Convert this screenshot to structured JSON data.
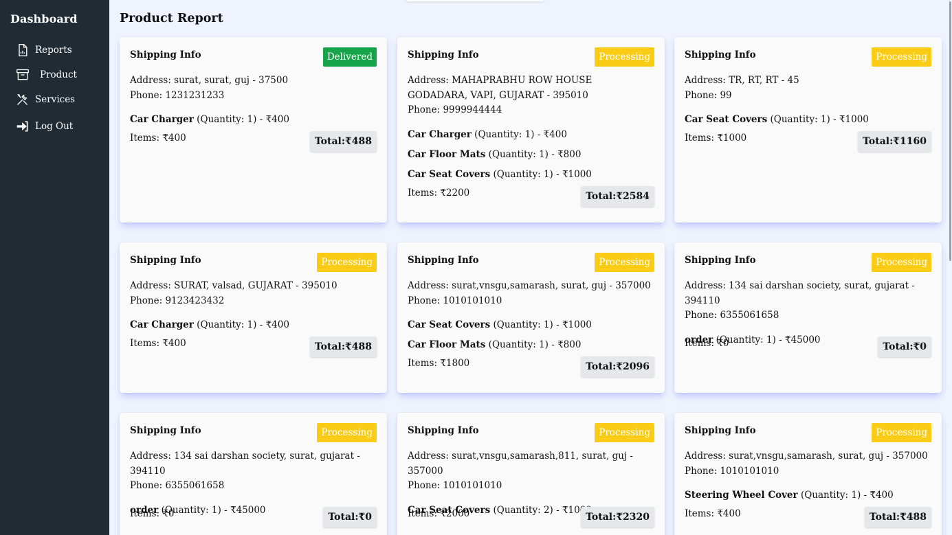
{
  "sidebar": {
    "title": "Dashboard",
    "items": [
      {
        "label": "Reports",
        "icon": "report-icon"
      },
      {
        "label": "Product",
        "icon": "archive-box-icon"
      },
      {
        "label": "Services",
        "icon": "tools-icon"
      },
      {
        "label": "Log Out",
        "icon": "logout-icon"
      }
    ]
  },
  "page": {
    "title": "Product Report"
  },
  "labels": {
    "shipping_info": "Shipping Info",
    "address_prefix": "Address: ",
    "phone_prefix": "Phone: ",
    "items_prefix": "Items: ",
    "total_prefix": "Total: ",
    "quantity_prefix": "(Quantity: ",
    "quantity_suffix": ") - "
  },
  "colors": {
    "delivered": "#16a34a",
    "processing": "#facc15",
    "sidebar": "#212b33",
    "background": "#eef3fd"
  },
  "orders": [
    {
      "status": "Delivered",
      "address": "surat, surat, guj - 37500",
      "phone": "1231231233",
      "items": [
        {
          "name": "Car Charger",
          "qty": "1",
          "price": "₹400"
        }
      ],
      "items_total": "₹400",
      "total": "₹488"
    },
    {
      "status": "Processing",
      "address": "MAHAPRABHU ROW HOUSE GODADARA, VAPI, GUJARAT - 395010",
      "phone": "9999944444",
      "items": [
        {
          "name": "Car Charger",
          "qty": "1",
          "price": "₹400"
        },
        {
          "name": "Car Floor Mats",
          "qty": "1",
          "price": "₹800"
        },
        {
          "name": "Car Seat Covers",
          "qty": "1",
          "price": "₹1000"
        }
      ],
      "items_total": "₹2200",
      "total": "₹2584"
    },
    {
      "status": "Processing",
      "address": "TR, RT, RT - 45",
      "phone": "99",
      "items": [
        {
          "name": "Car Seat Covers",
          "qty": "1",
          "price": "₹1000"
        }
      ],
      "items_total": "₹1000",
      "total": "₹1160"
    },
    {
      "status": "Processing",
      "address": "SURAT, valsad, GUJARAT - 395010",
      "phone": "9123423432",
      "items": [
        {
          "name": "Car Charger",
          "qty": "1",
          "price": "₹400"
        }
      ],
      "items_total": "₹400",
      "total": "₹488"
    },
    {
      "status": "Processing",
      "address": "surat,vnsgu,samarash, surat, guj - 357000",
      "phone": "1010101010",
      "items": [
        {
          "name": "Car Seat Covers",
          "qty": "1",
          "price": "₹1000"
        },
        {
          "name": "Car Floor Mats",
          "qty": "1",
          "price": "₹800"
        }
      ],
      "items_total": "₹1800",
      "total": "₹2096"
    },
    {
      "status": "Processing",
      "address": "134 sai darshan society, surat, gujarat - 394110",
      "phone": "6355061658",
      "items": [
        {
          "name": "order",
          "qty": "1",
          "price": "₹45000"
        }
      ],
      "items_total": "₹0",
      "total": "₹0"
    },
    {
      "status": "Processing",
      "address": "134 sai darshan society, surat, gujarat - 394110",
      "phone": "6355061658",
      "items": [
        {
          "name": "order",
          "qty": "1",
          "price": "₹45000"
        }
      ],
      "items_total": "₹0",
      "total": "₹0"
    },
    {
      "status": "Processing",
      "address": "surat,vnsgu,samarash,811, surat, guj - 357000",
      "phone": "1010101010",
      "items": [
        {
          "name": "Car Seat Covers",
          "qty": "2",
          "price": "₹1000"
        }
      ],
      "items_total": "₹2000",
      "total": "₹2320"
    },
    {
      "status": "Processing",
      "address": "surat,vnsgu,samarash, surat, guj - 357000",
      "phone": "1010101010",
      "items": [
        {
          "name": "Steering Wheel Cover",
          "qty": "1",
          "price": "₹400"
        }
      ],
      "items_total": "₹400",
      "total": "₹488"
    }
  ]
}
